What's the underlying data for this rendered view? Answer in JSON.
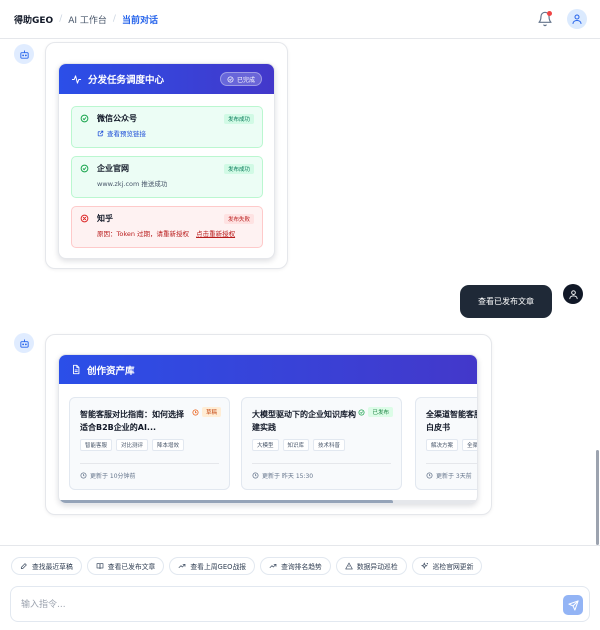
{
  "header": {
    "breadcrumb": [
      "得助GEO",
      "AI 工作台",
      "当前对话"
    ]
  },
  "dispatch": {
    "title": "分发任务调度中心",
    "status_badge": "已完成",
    "tasks": [
      {
        "name": "微信公众号",
        "status": "发布成功",
        "detail": "查看预览链接",
        "state": "success"
      },
      {
        "name": "企业官网",
        "status": "发布成功",
        "detail": "www.zkj.com 推送成功",
        "state": "success"
      },
      {
        "name": "知乎",
        "status": "发布失败",
        "detail": "原因：Token 过期，请重新授权",
        "action": "点击重新授权",
        "state": "failed"
      }
    ]
  },
  "user_message": "查看已发布文章",
  "assets": {
    "title": "创作资产库",
    "items": [
      {
        "title": "智能客服对比指南：如何选择适合B2B企业的AI...",
        "status": "草稿",
        "tags": [
          "智能客服",
          "对比测评",
          "降本增效"
        ],
        "updated": "更新于 10分钟前"
      },
      {
        "title": "大模型驱动下的企业知识库构建实践",
        "status": "已发布",
        "tags": [
          "大模型",
          "知识库",
          "技术科普"
        ],
        "updated": "更新于 昨天 15:30"
      },
      {
        "title": "全渠道智能客服白皮书",
        "status": "",
        "tags": [
          "解决方案",
          "全渠"
        ],
        "updated": "更新于 3天前"
      }
    ]
  },
  "quick_actions": [
    "查找最近草稿",
    "查看已发布文章",
    "查看上周GEO战报",
    "查询排名趋势",
    "数据异动巡检",
    "巡检官网更新"
  ],
  "input": {
    "placeholder": "输入指令...",
    "value": ""
  },
  "colors": {
    "accent": "#2563eb",
    "header_gradient_start": "#2b4fe8",
    "header_gradient_end": "#4338ca",
    "success": "#16a34a",
    "error": "#dc2626"
  }
}
